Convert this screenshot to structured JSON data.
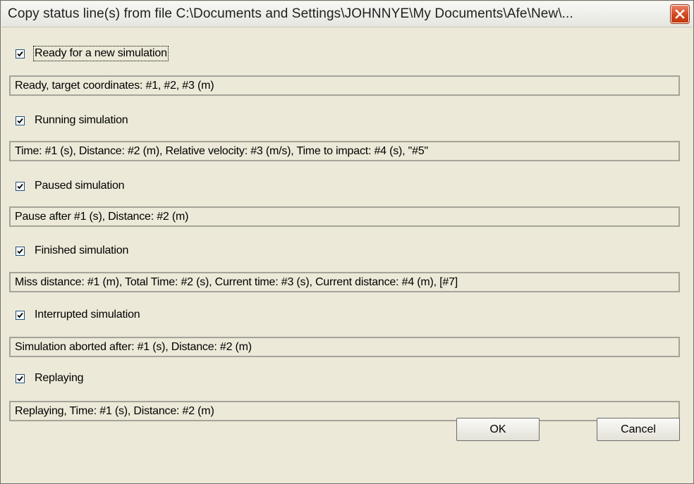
{
  "window": {
    "title": "Copy status line(s) from file C:\\Documents and Settings\\JOHNNYE\\My Documents\\Afe\\New\\...",
    "close_icon": "close-icon"
  },
  "sections": [
    {
      "label": "Ready for a new simulation",
      "checked": true,
      "value": "Ready, target coordinates: #1, #2, #3 (m)"
    },
    {
      "label": "Running simulation",
      "checked": true,
      "value": "Time: #1 (s), Distance: #2 (m), Relative velocity: #3 (m/s), Time to impact: #4 (s), \"#5\""
    },
    {
      "label": "Paused simulation",
      "checked": true,
      "value": "Pause after #1 (s), Distance: #2 (m)"
    },
    {
      "label": "Finished simulation",
      "checked": true,
      "value": "Miss distance: #1 (m), Total Time: #2 (s), Current time: #3 (s), Current distance: #4 (m), [#7]"
    },
    {
      "label": "Interrupted simulation",
      "checked": true,
      "value": "Simulation aborted after: #1 (s), Distance: #2 (m)"
    },
    {
      "label": "Replaying",
      "checked": true,
      "value": "Replaying, Time: #1 (s), Distance: #2 (m)"
    }
  ],
  "buttons": {
    "ok": "OK",
    "cancel": "Cancel"
  }
}
